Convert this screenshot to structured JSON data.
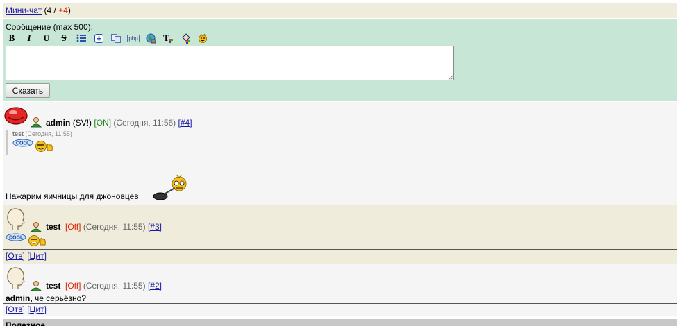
{
  "header": {
    "link": "Мини-чат",
    "open_paren": "(",
    "count": "4",
    "slash": " / ",
    "new_count": "+4",
    "close_paren": ")"
  },
  "composer": {
    "label": "Сообщение (max 500):",
    "toolbar": [
      {
        "name": "bold",
        "glyph": "B"
      },
      {
        "name": "italic",
        "glyph": "I"
      },
      {
        "name": "underline",
        "glyph": "U"
      },
      {
        "name": "strike",
        "glyph": "S"
      },
      {
        "name": "list",
        "glyph": ""
      },
      {
        "name": "spoiler",
        "glyph": ""
      },
      {
        "name": "copy",
        "glyph": ""
      },
      {
        "name": "php",
        "glyph": "php"
      },
      {
        "name": "url",
        "glyph": ""
      },
      {
        "name": "color",
        "glyph": "T"
      },
      {
        "name": "fill",
        "glyph": ""
      },
      {
        "name": "smiley",
        "glyph": ""
      }
    ],
    "textarea_value": "",
    "submit_label": "Сказать"
  },
  "messages": [
    {
      "author": "admin",
      "role": "(SV!)",
      "status": "[ON]",
      "time": "(Сегодня, 11:56)",
      "id_link": "[#4]",
      "quote_author": "test",
      "quote_time": "(Сегодня, 11:55)",
      "quote_smiley": "cool",
      "text": "Нажарим яичницы для джоновцев"
    },
    {
      "author": "test",
      "status": "[Off]",
      "time": "(Сегодня, 11:55)",
      "id_link": "[#3]",
      "smiley": "cool",
      "reply": "[Отв]",
      "quote": "[Цит]"
    },
    {
      "author": "test",
      "status": "[Off]",
      "time": "(Сегодня, 11:55)",
      "id_link": "[#2]",
      "addressee": "admin,",
      "text": " че серьёзно?",
      "reply": "[Отв]",
      "quote": "[Цит]"
    }
  ],
  "footer": {
    "label": "Полезное"
  },
  "colors": {
    "header_bg": "#f0ecdc",
    "composer_bg": "#c7e6d5",
    "link": "#1a1aa6",
    "status_on": "#228822",
    "status_off": "#dd2200"
  }
}
